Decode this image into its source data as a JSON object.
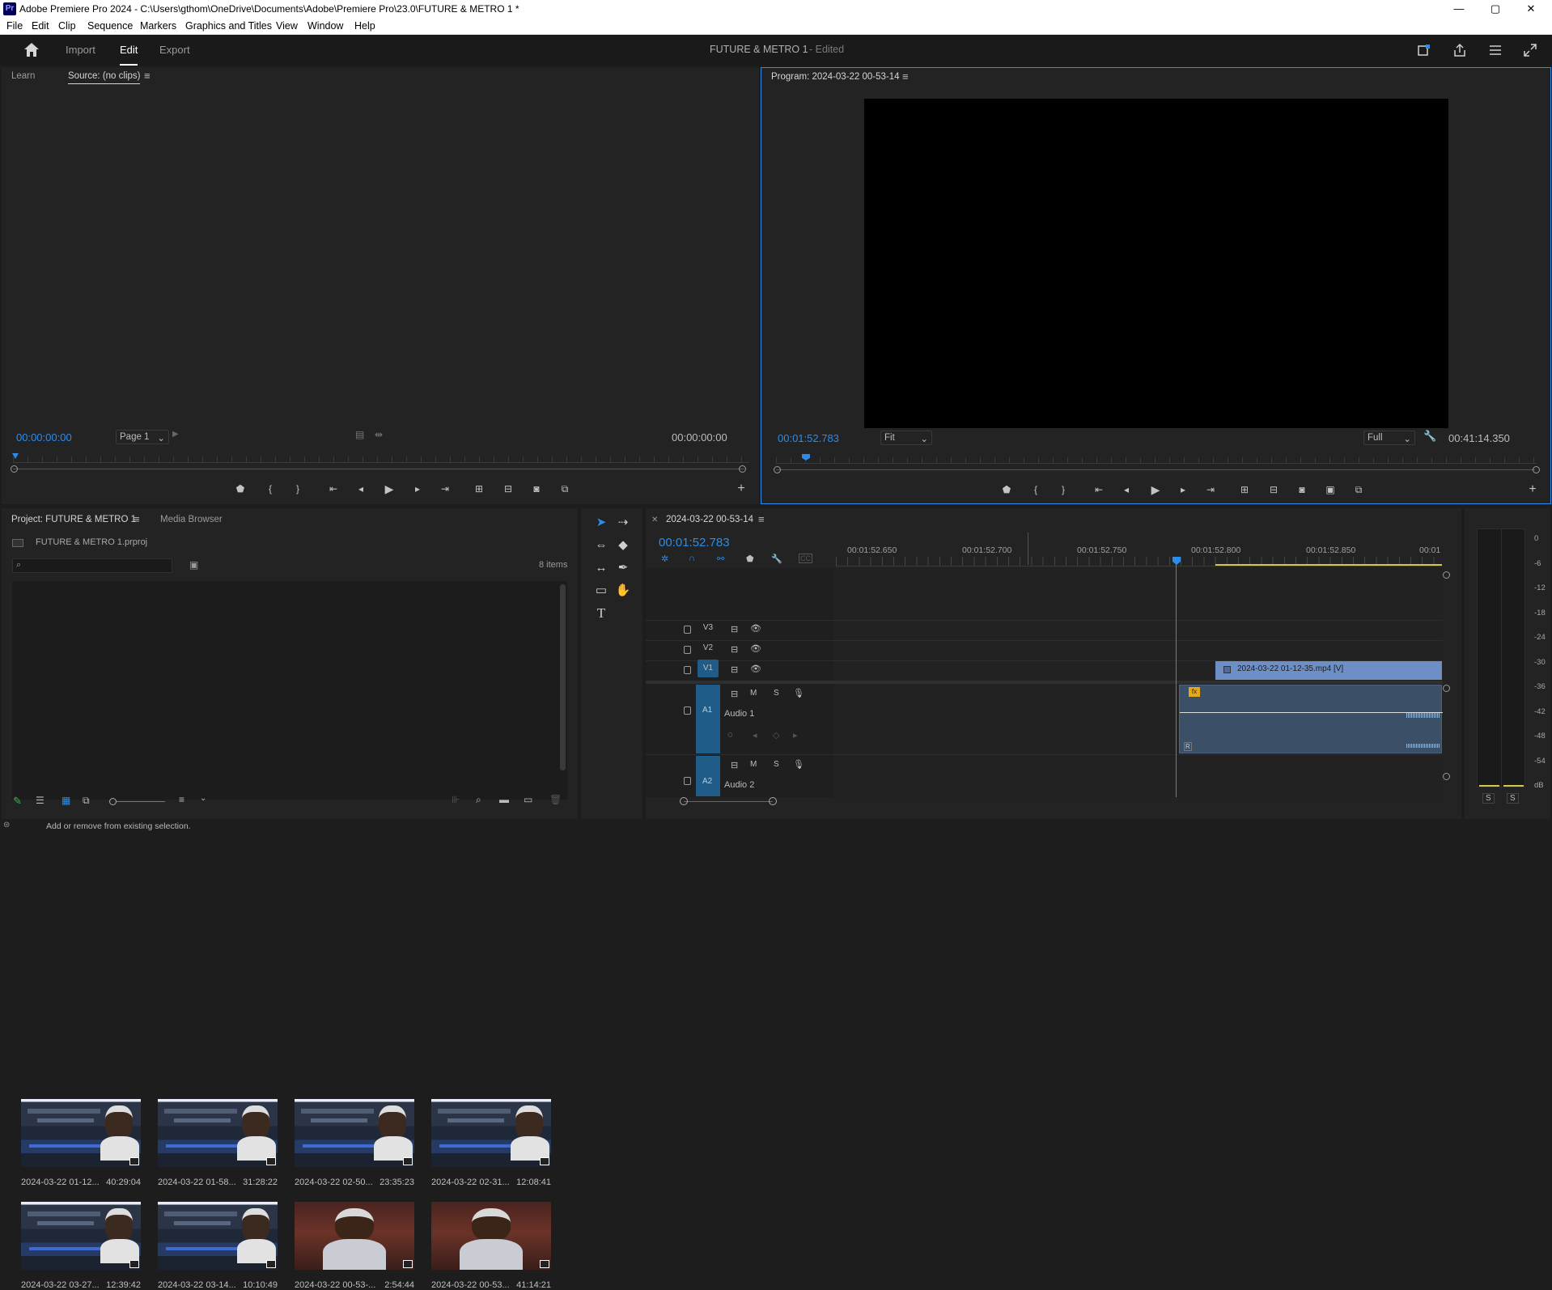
{
  "titlebar": {
    "app_icon": "Pr",
    "title": "Adobe Premiere Pro 2024 - C:\\Users\\gthom\\OneDrive\\Documents\\Adobe\\Premiere Pro\\23.0\\FUTURE & METRO 1 *",
    "minimize": "—",
    "maximize": "▢",
    "close": "✕"
  },
  "menu": [
    "File",
    "Edit",
    "Clip",
    "Sequence",
    "Markers",
    "Graphics and Titles",
    "View",
    "Window",
    "Help"
  ],
  "workspace": {
    "tabs": [
      "Import",
      "Edit",
      "Export"
    ],
    "active": "Edit",
    "project_title": "FUTURE & METRO 1",
    "edited_suffix": "- Edited"
  },
  "source_panel": {
    "tabs": [
      "Learn",
      "Source: (no clips)"
    ],
    "timecode_in": "00:00:00:00",
    "page_select": "Page 1",
    "timecode_out": "00:00:00:00"
  },
  "program_panel": {
    "title": "Program: 2024-03-22 00-53-14",
    "timecode": "00:01:52.783",
    "fit_select": "Fit",
    "quality_select": "Full",
    "duration": "00:41:14.350"
  },
  "project_panel": {
    "tabs": [
      "Project: FUTURE & METRO 1",
      "Media Browser"
    ],
    "project_file": "FUTURE & METRO 1.prproj",
    "search_placeholder": "",
    "items_count": "8 items",
    "items": [
      {
        "name": "2024-03-22 01-12...",
        "duration": "40:29:04",
        "kind": "screen"
      },
      {
        "name": "2024-03-22 01-58...",
        "duration": "31:28:22",
        "kind": "screen"
      },
      {
        "name": "2024-03-22 02-50...",
        "duration": "23:35:23",
        "kind": "screen"
      },
      {
        "name": "2024-03-22 02-31...",
        "duration": "12:08:41",
        "kind": "screen"
      },
      {
        "name": "2024-03-22 03-27...",
        "duration": "12:39:42",
        "kind": "screen"
      },
      {
        "name": "2024-03-22 03-14...",
        "duration": "10:10:49",
        "kind": "screen"
      },
      {
        "name": "2024-03-22 00-53-...",
        "duration": "2:54:44",
        "kind": "person"
      },
      {
        "name": "2024-03-22 00-53...",
        "duration": "41:14:21",
        "kind": "person"
      }
    ]
  },
  "timeline": {
    "sequence_name": "2024-03-22 00-53-14",
    "timecode": "00:01:52.783",
    "ruler": [
      "00:01:52.650",
      "00:01:52.700",
      "00:01:52.750",
      "00:01:52.800",
      "00:01:52.850",
      "00:01"
    ],
    "video_tracks": [
      "V3",
      "V2",
      "V1"
    ],
    "audio_tracks": [
      {
        "id": "A1",
        "name": "Audio 1"
      },
      {
        "id": "A2",
        "name": "Audio 2"
      }
    ],
    "track_buttons": {
      "mute": "M",
      "solo": "S"
    },
    "video_clip": "2024-03-22 01-12-35.mp4 [V]",
    "fx_badge": "fx",
    "audio_clip_marker": "R"
  },
  "meter": {
    "labels": [
      "0",
      "-6",
      "-12",
      "-18",
      "-24",
      "-30",
      "-36",
      "-42",
      "-48",
      "-54",
      "dB"
    ],
    "solo_buttons": [
      "S",
      "S"
    ]
  },
  "status_bar": {
    "text": "Add or remove from existing selection."
  },
  "colors": {
    "accent": "#2d8ceb",
    "clip_blue": "#6d8fc5",
    "audio_clip": "#3b4f66",
    "track_blue": "#1f5c88"
  }
}
